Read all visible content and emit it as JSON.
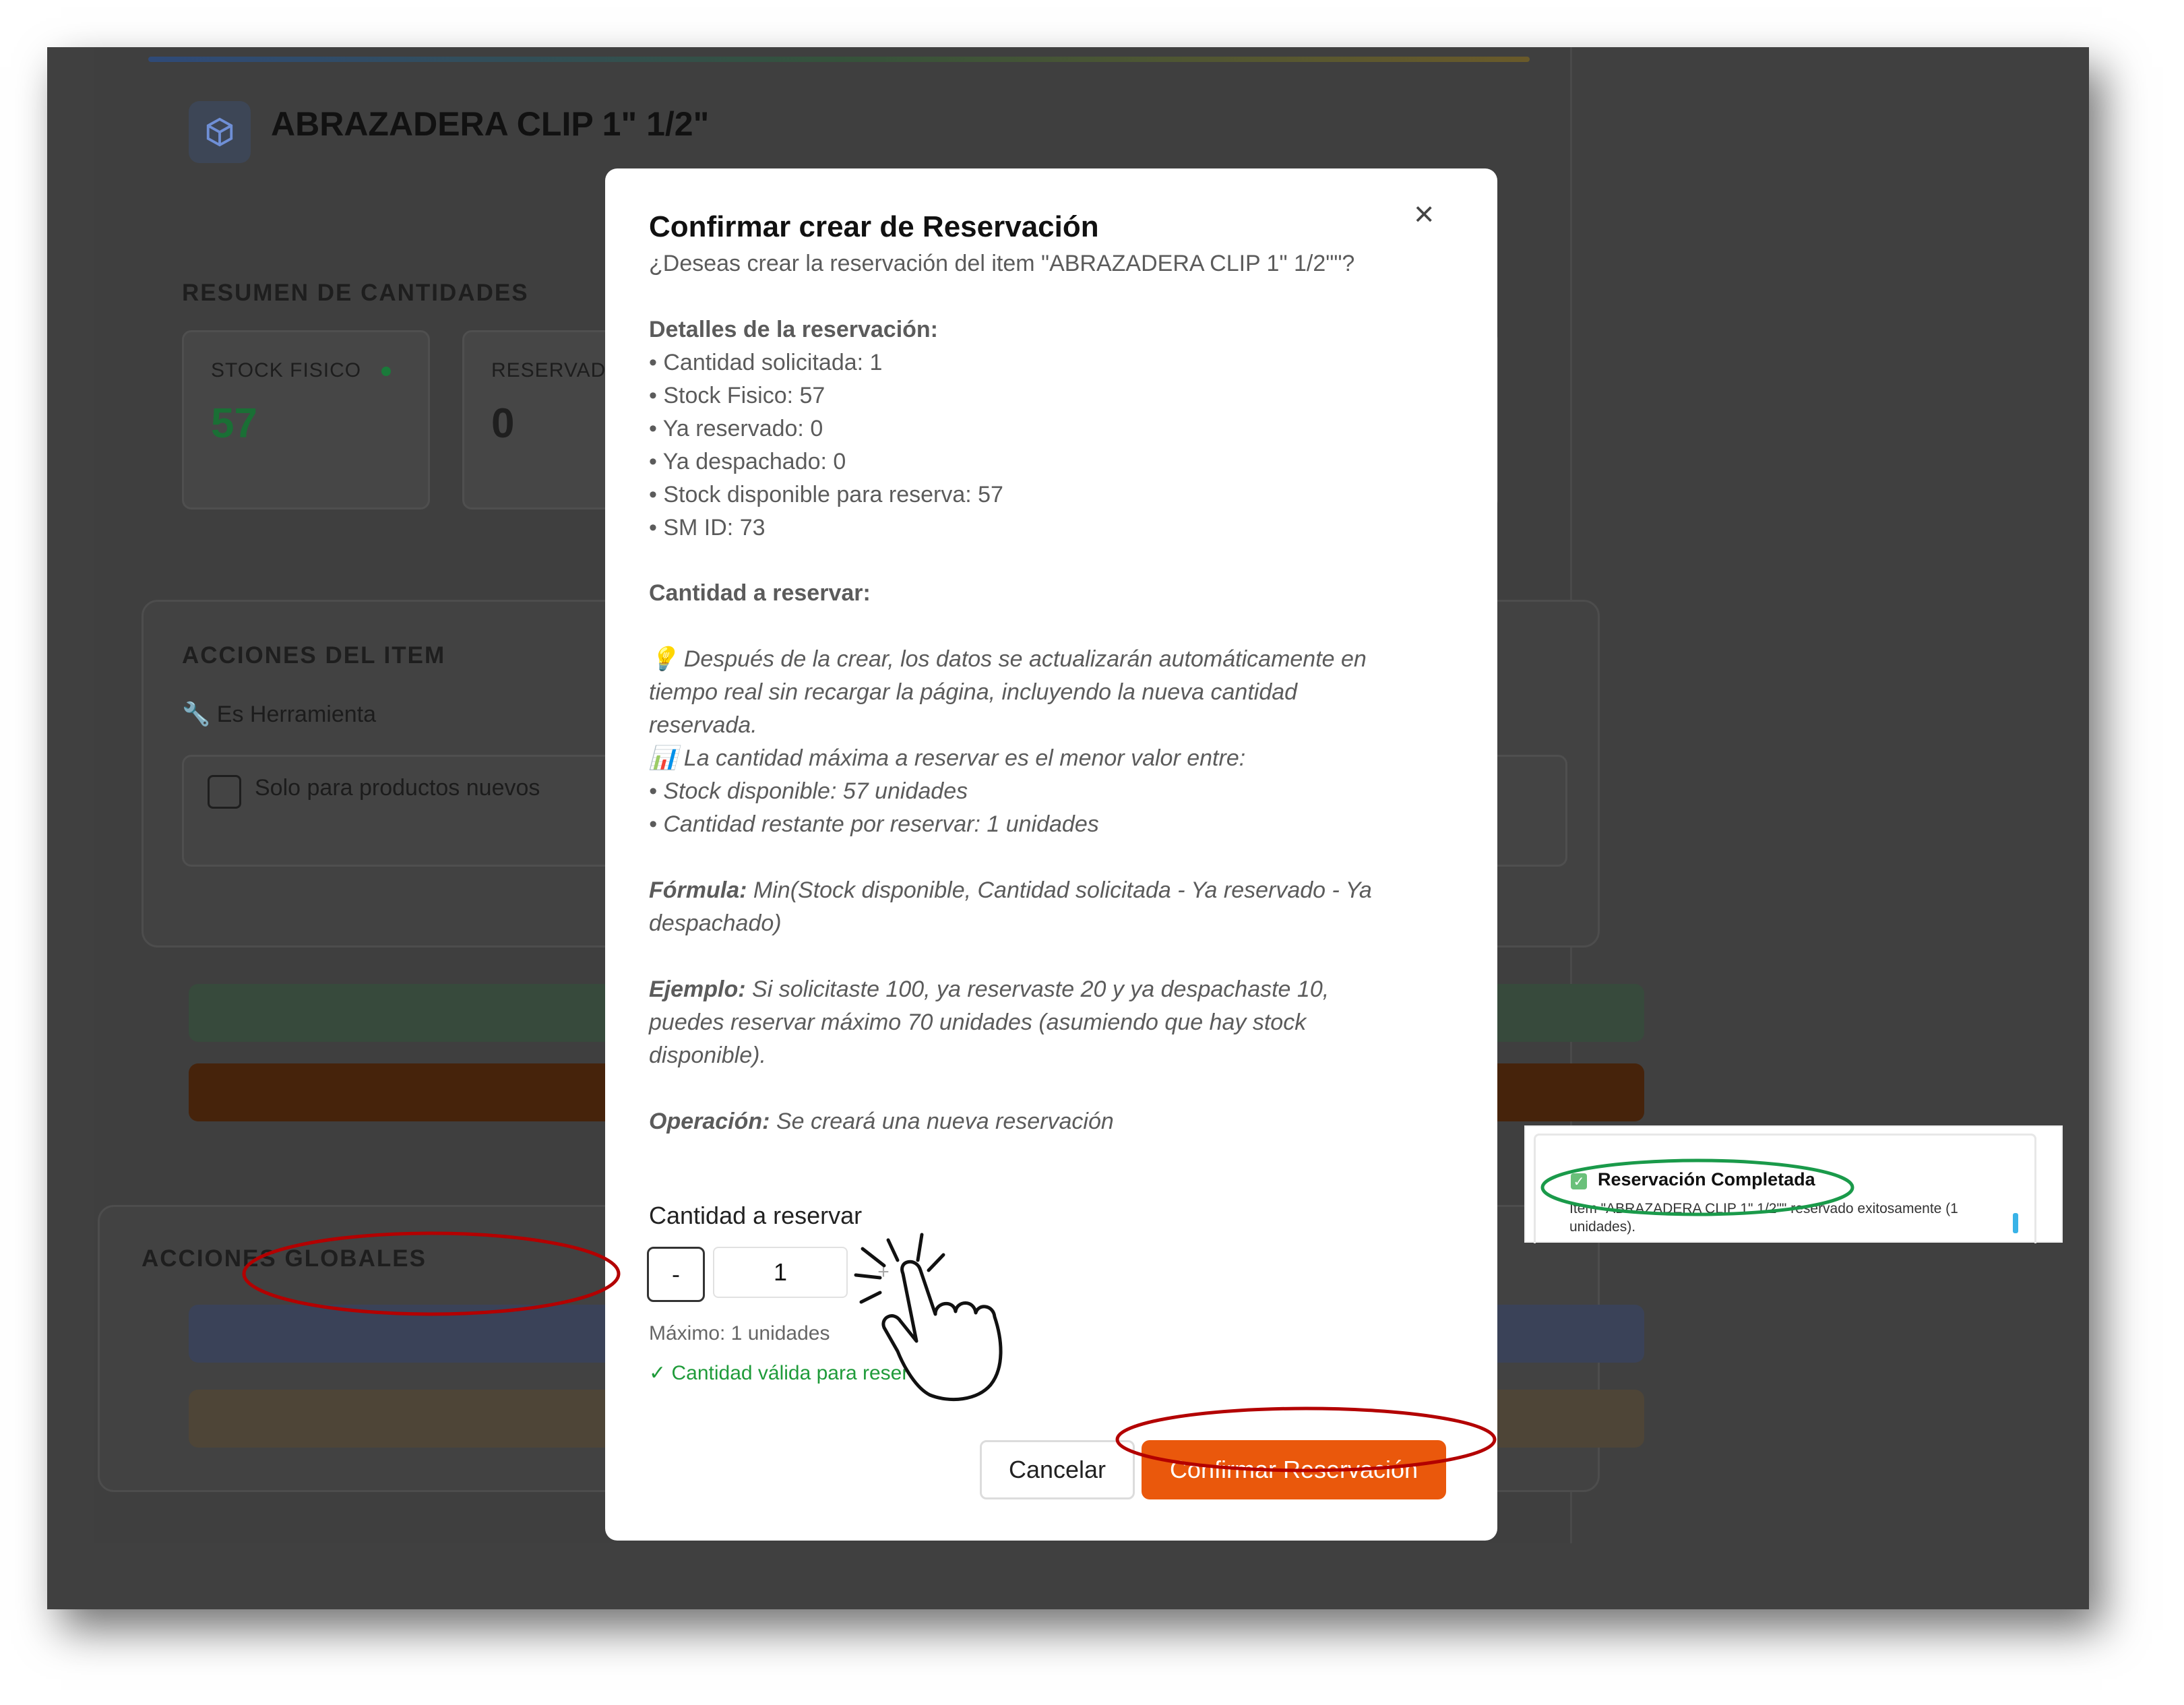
{
  "item": {
    "title": "ABRAZADERA CLIP 1\" 1/2\"",
    "icon": "box-icon"
  },
  "summary": {
    "heading": "RESUMEN DE CANTIDADES",
    "cards": [
      {
        "label": "STOCK FISICO",
        "value": "57",
        "color": "#1a7a3a"
      },
      {
        "label": "RESERVAD",
        "value": "0",
        "color": "#1f1f1f"
      }
    ],
    "partial_label": "R"
  },
  "actions": {
    "heading": "ACCIONES DEL ITEM",
    "tool_label": "Es Herramienta",
    "checkbox_label": "Solo para productos nuevos"
  },
  "global_actions": {
    "heading": "ACCIONES GLOBALES"
  },
  "modal": {
    "title": "Confirmar crear de Reservación",
    "subtitle": "¿Deseas crear la reservación del item \"ABRAZADERA CLIP 1\" 1/2\"\"?",
    "details_heading": "Detalles de la reservación:",
    "details": [
      "• Cantidad solicitada: 1",
      "• Stock Fisico: 57",
      "• Ya reservado: 0",
      "• Ya despachado: 0",
      "• Stock disponible para reserva: 57",
      "• SM ID: 73"
    ],
    "qty_heading": "Cantidad a reservar:",
    "info_line1": "Después de la crear, los datos se actualizarán automáticamente en",
    "info_line2": "tiempo real sin recargar la página, incluyendo la nueva cantidad",
    "info_line3": "reservada.",
    "max_info": "La cantidad máxima a reservar es el menor valor entre:",
    "max_item1": "• Stock disponible: 57 unidades",
    "max_item2": "• Cantidad restante por reservar: 1 unidades",
    "formula_label": "Fórmula:",
    "formula_line1": "Min(Stock disponible, Cantidad solicitada - Ya reservado - Ya",
    "formula_line2": "despachado)",
    "example_label": "Ejemplo:",
    "example_line1": "Si solicitaste 100, ya reservaste 20 y ya despachaste 10,",
    "example_line2": "puedes reservar máximo 70 unidades (asumiendo que hay stock",
    "example_line3": "disponible).",
    "operation_label": "Operación:",
    "operation_text": "Se creará una nueva reservación",
    "input_label": "Cantidad a reservar",
    "minus": "-",
    "plus": "+",
    "qty_value": "1",
    "max_text": "Máximo: 1 unidades",
    "valid_text": "✓ Cantidad válida para reservar",
    "cancel": "Cancelar",
    "confirm": "Confirmar Reservación",
    "close": "×"
  },
  "toast": {
    "title": "Reservación Completada",
    "message": "Item \"ABRAZADERA CLIP 1\" 1/2\"\" reservado exitosamente (1 unidades).",
    "check": "✓"
  },
  "colors": {
    "accent": "#ea580c",
    "annotation_red": "#b30000",
    "annotation_green": "#1a9a4a",
    "success": "#1f9b3a"
  }
}
